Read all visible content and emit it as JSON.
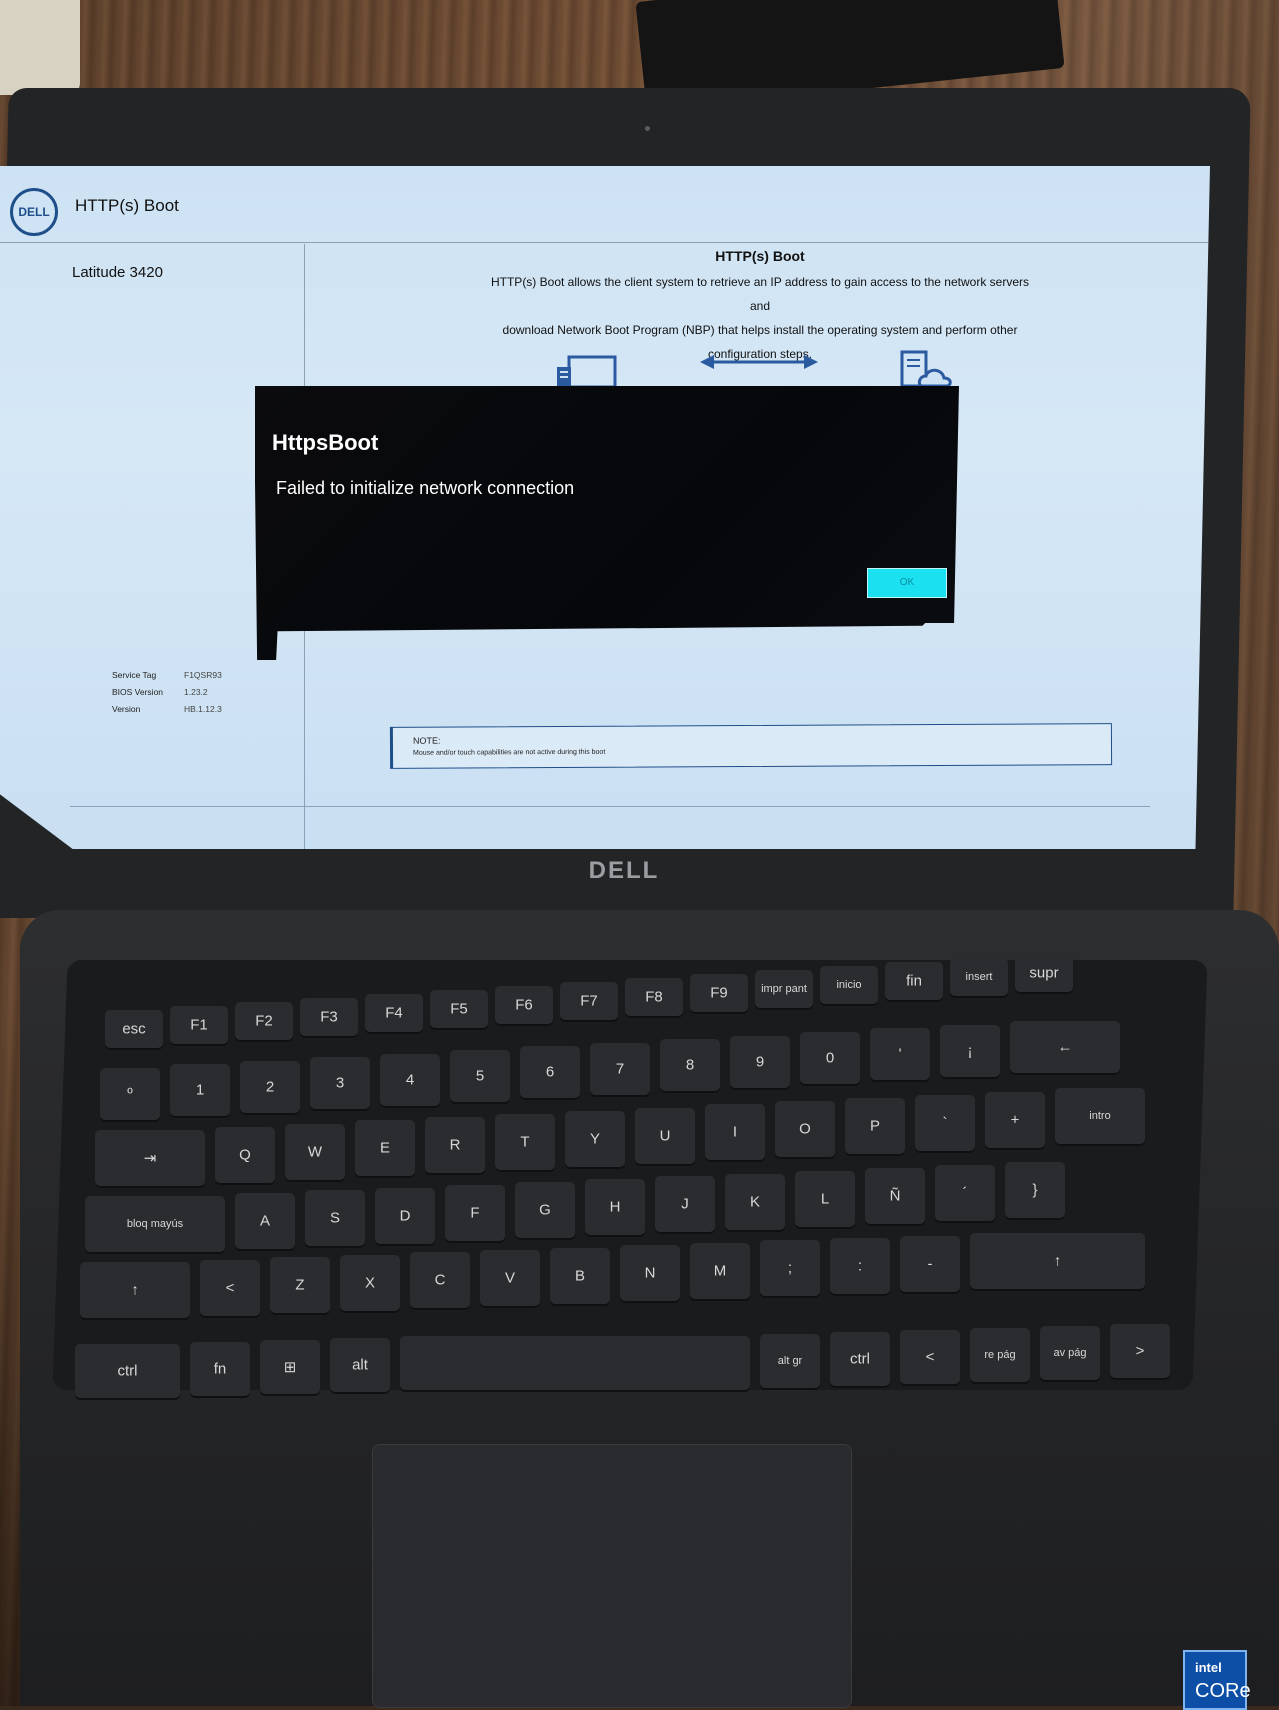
{
  "app": {
    "logo_text": "DELL",
    "title": "HTTP(s) Boot",
    "model": "Latitude 3420"
  },
  "info": {
    "title": "HTTP(s) Boot",
    "line1": "HTTP(s) Boot allows the client system to retrieve an IP address to gain access to the network servers and",
    "line2": "download Network Boot Program (NBP) that helps install the operating system and perform other",
    "line3": "configuration steps."
  },
  "system_info": {
    "service_tag_label": "Service Tag",
    "service_tag_value": "F1QSR93",
    "bios_version_label": "BIOS Version",
    "bios_version_value": "1.23.2",
    "version_label": "Version",
    "version_value": "HB.1.12.3"
  },
  "note": {
    "title": "NOTE:",
    "text": "Mouse and/or touch capabilities are not active during this boot"
  },
  "dialog": {
    "title": "HttpsBoot",
    "message": "Failed to initialize network connection",
    "ok_label": "OK"
  },
  "hardware": {
    "lid_logo": "DELL",
    "intel_line1": "intel",
    "intel_line2": "CORe"
  },
  "keyboard": {
    "row_fn": [
      "esc",
      "F1",
      "F2",
      "F3",
      "F4",
      "F5",
      "F6",
      "F7",
      "F8",
      "F9",
      "impr pant",
      "inicio",
      "fin",
      "insert",
      "supr"
    ],
    "row_num": [
      "º",
      "1",
      "2",
      "3",
      "4",
      "5",
      "6",
      "7",
      "8",
      "9",
      "0",
      "'",
      "¡",
      "←"
    ],
    "row_q": [
      "⇥",
      "Q",
      "W",
      "E",
      "R",
      "T",
      "Y",
      "U",
      "I",
      "O",
      "P",
      "`",
      "+",
      "intro"
    ],
    "row_a": [
      "bloq mayús",
      "A",
      "S",
      "D",
      "F",
      "G",
      "H",
      "J",
      "K",
      "L",
      "Ñ",
      "´",
      "}"
    ],
    "row_z": [
      "↑",
      "<",
      "Z",
      "X",
      "C",
      "V",
      "B",
      "N",
      "M",
      ";",
      ":",
      "-",
      "↑"
    ],
    "row_bottom": [
      "ctrl",
      "fn",
      "⊞",
      "alt",
      "",
      "alt gr",
      "ctrl",
      "<",
      "re pág",
      "av pág",
      ">"
    ]
  }
}
